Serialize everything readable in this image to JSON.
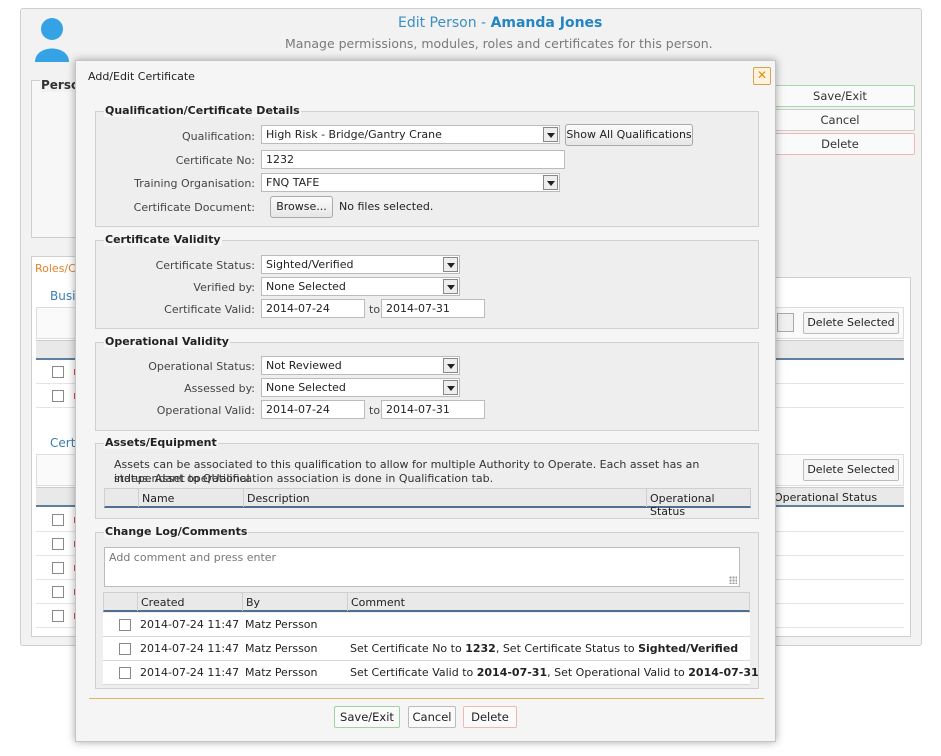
{
  "page": {
    "title_prefix": "Edit Person - ",
    "person_name": "Amanda Jones",
    "subtitle": "Manage permissions, modules, roles and certificates for this person.",
    "person_section_label": "Person",
    "buttons": {
      "save": "Save/Exit",
      "cancel": "Cancel",
      "delete": "Delete"
    },
    "tab_label": "Roles/Certificates",
    "section_business": "Business",
    "section_certificates": "Certificates",
    "delete_selected": "Delete Selected",
    "operational_status_header": "Operational Status"
  },
  "dialog": {
    "title": "Add/Edit Certificate",
    "close_icon": "close-icon",
    "qualification_details": {
      "legend": "Qualification/Certificate Details",
      "qualification_label": "Qualification:",
      "qualification_value": "High Risk - Bridge/Gantry Crane",
      "show_all_button": "Show All Qualifications",
      "certificate_no_label": "Certificate No:",
      "certificate_no_value": "1232",
      "training_org_label": "Training Organisation:",
      "training_org_value": "FNQ TAFE",
      "document_label": "Certificate Document:",
      "browse_button": "Browse...",
      "no_files_text": "No files selected."
    },
    "certificate_validity": {
      "legend": "Certificate Validity",
      "status_label": "Certificate Status:",
      "status_value": "Sighted/Verified",
      "verified_by_label": "Verified by:",
      "verified_by_value": "None Selected",
      "valid_label": "Certificate Valid:",
      "valid_from": "2014-07-24",
      "to_text": "to",
      "valid_to": "2014-07-31"
    },
    "operational_validity": {
      "legend": "Operational Validity",
      "status_label": "Operational Status:",
      "status_value": "Not Reviewed",
      "assessed_by_label": "Assessed by:",
      "assessed_by_value": "None Selected",
      "valid_label": "Operational Valid:",
      "valid_from": "2014-07-24",
      "to_text": "to",
      "valid_to": "2014-07-31"
    },
    "assets": {
      "legend": "Assets/Equipment",
      "note_line1": "Assets can be associated to this qualification to allow for multiple Authority to Operate. Each asset has an independant operational",
      "note_line2": "status. Asset to QUalification association is done in Qualification tab.",
      "columns": [
        "Name",
        "Description",
        "Operational Status"
      ]
    },
    "change_log": {
      "legend": "Change Log/Comments",
      "comment_placeholder": "Add comment and press enter",
      "columns": [
        "Created",
        "By",
        "Comment"
      ],
      "rows": [
        {
          "created": "2014-07-24 11:47",
          "by": "Matz Persson",
          "c1": "",
          "b1": "",
          "c2": "",
          "b2": ""
        },
        {
          "created": "2014-07-24 11:47",
          "by": "Matz Persson",
          "c1": "Set Certificate No to ",
          "b1": "1232",
          "c2": ", Set Certificate Status to ",
          "b2": "Sighted/Verified"
        },
        {
          "created": "2014-07-24 11:47",
          "by": "Matz Persson",
          "c1": "Set Certificate Valid to ",
          "b1": "2014-07-31",
          "c2": ", Set Operational Valid to ",
          "b2": "2014-07-31"
        }
      ]
    },
    "footer": {
      "save": "Save/Exit",
      "cancel": "Cancel",
      "delete": "Delete"
    }
  },
  "colors": {
    "title_blue": "#2385c3",
    "orange_accent": "#e8880f",
    "grid_border": "#4f6f8f"
  }
}
